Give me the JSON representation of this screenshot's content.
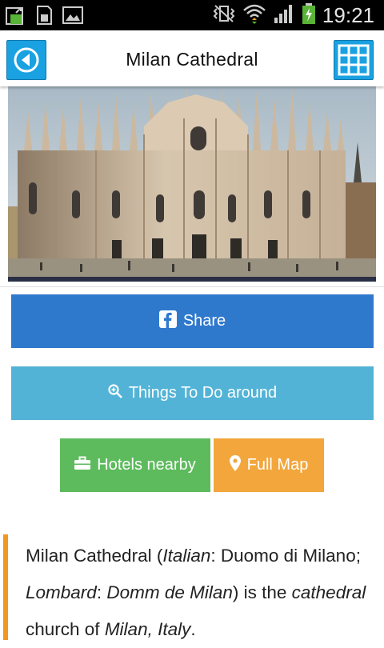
{
  "status_bar": {
    "time": "19:21",
    "left_icons": [
      "upload-icon",
      "sd-card-icon",
      "image-icon"
    ],
    "right_icons": [
      "vibrate-icon",
      "wifi-icon",
      "signal-icon",
      "battery-icon"
    ]
  },
  "header": {
    "title": "Milan Cathedral",
    "back_icon": "back-arrow-icon",
    "menu_icon": "grid-icon",
    "accent": "#1aa1e1"
  },
  "buttons": {
    "share": "Share",
    "things_to_do": "Things To Do around",
    "hotels": "Hotels nearby",
    "full_map": "Full Map"
  },
  "colors": {
    "share": "#2f79cd",
    "things_to_do": "#52b3d6",
    "hotels": "#5dbb5d",
    "full_map": "#f2a63c",
    "description_bar": "#f29722"
  },
  "description": {
    "p1": "Milan Cathedral (",
    "i1": "Italian",
    "p2": ": Duomo di Milano; ",
    "i2": "Lombard",
    "p3": ": ",
    "i3": "Domm de Milan",
    "p4": ") is the ",
    "i4": "cathedral",
    "p5": " church of ",
    "i5": "Milan, Italy",
    "p6": "."
  }
}
